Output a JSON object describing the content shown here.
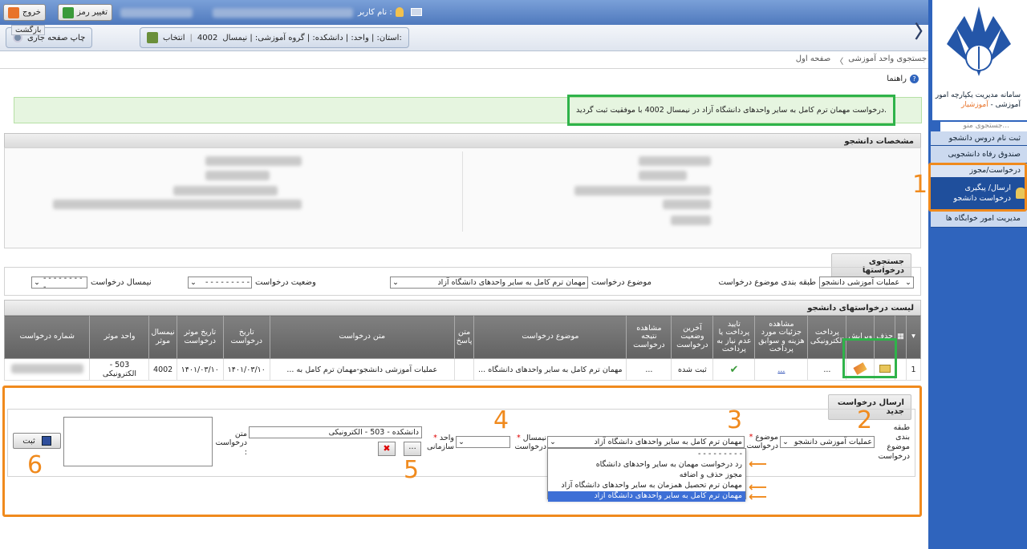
{
  "topbar": {
    "exit_label": "خروج",
    "change_pass_label": "تغییر رمز",
    "username_label": "نام کاربر :"
  },
  "bar2": {
    "back_label": "بازگشت",
    "print_label": "چاپ صفحه جاری",
    "select_label": "انتخاب",
    "semester_value": "4002",
    "info_text": "استان: | واحد: | دانشکده: | گروه آموزشی: | نیمسال:"
  },
  "breadcrumb": {
    "home": "صفحه اول",
    "sep": "〈",
    "current": "جستجوی واحد آموزشی"
  },
  "help_label": "راهنما",
  "success_message": "درخواست مهمان ترم کامل به سایر واحدهای دانشگاه آزاد در نیمسال 4002 با موفقیت ثبت گردید.",
  "student_section_title": "مشخصات دانشجو",
  "search_section": {
    "title": "جستجوی درخواستها",
    "category_label": "طبقه بندی موضوع درخواست",
    "category_value": "عملیات آموزشی دانشجو",
    "subject_label": "موضوع درخواست",
    "subject_value": "مهمان ترم کامل به سایر واحدهای دانشگاه آزاد",
    "status_label": "وضعیت درخواست",
    "status_value": "- - - - - - - - -",
    "semester_label": "نیمسال درخواست",
    "semester_value": "- - - - - - - - -"
  },
  "list_section": {
    "title": "لیست درخواستهای دانشجو",
    "headers": [
      "حذف",
      "ویرایش",
      "پرداخت الکترونیکی",
      "مشاهده جزئیات مورد هزینه و سوابق پرداخت",
      "تایید پرداخت یا عدم نیاز به پرداخت",
      "آخرین وضعیت درخواست",
      "مشاهده نتیجه درخواست",
      "موضوع درخواست",
      "متن پاسخ",
      "متن درخواست",
      "تاریخ درخواست",
      "تاریخ موثر درخواست",
      "نیمسال موثر",
      "واحد موثر",
      "شماره درخواست"
    ],
    "row": {
      "index": "1",
      "details": "...",
      "result": "...",
      "status": "ثبت شده",
      "subject": "مهمان ترم کامل به سایر واحدهای دانشگاه ...",
      "text": "عملیات آموزشی دانشجو-مهمان ترم کامل به ...",
      "date": "۱۴۰۱/۰۳/۱۰",
      "eff_date": "۱۴۰۱/۰۳/۱۰",
      "eff_semester": "4002",
      "eff_unit": "503 - الکترونیکی"
    }
  },
  "new_request": {
    "title": "ارسال درخواست جدید",
    "category_label": "طبقه بندی موضوع درخواست",
    "category_value": "عملیات آموزشی دانشجو",
    "subject_label": "موضوع درخواست",
    "subject_value": "مهمان ترم کامل به سایر واحدهای دانشگاه آزاد",
    "semester_label": "نیمسال درخواست",
    "unit_label": "واحد سازمانی",
    "unit_value": "دانشکده - 503 - الکترونیکی",
    "browse_label": "...",
    "text_label": "متن درخواست :",
    "submit_label": "ثبت",
    "options": [
      "- - - - - - - - -",
      "رد درخواست مهمان به سایر واحدهای دانشگاه",
      "مجوز حذف و اضافه",
      "مهمان ترم تحصیل همزمان به سایر واحدهای دانشگاه آزاد",
      "مهمان ترم کامل به سایر واحدهای دانشگاه آزاد"
    ]
  },
  "annotations": [
    "1",
    "2",
    "3",
    "4",
    "5",
    "6"
  ],
  "sidebar": {
    "logo_line1": "سامانه مدیریت یکپارچه امور",
    "logo_line2": "آموزشی - ",
    "logo_brand": "آموزشیار",
    "search_placeholder": "جستجوی منو...",
    "items": [
      "ثبت نام دروس دانشجو",
      "صندوق رفاه دانشجویی",
      "درخواست/مجوز",
      "ارسال/ پیگیری درخواست دانشجو",
      "مدیریت امور خوابگاه ها"
    ]
  },
  "colors": {
    "accent_orange": "#f08a1d",
    "highlight_green": "#2fb34a",
    "sidebar_blue": "#2f64bd",
    "selected_option": "#3d6fd6"
  }
}
